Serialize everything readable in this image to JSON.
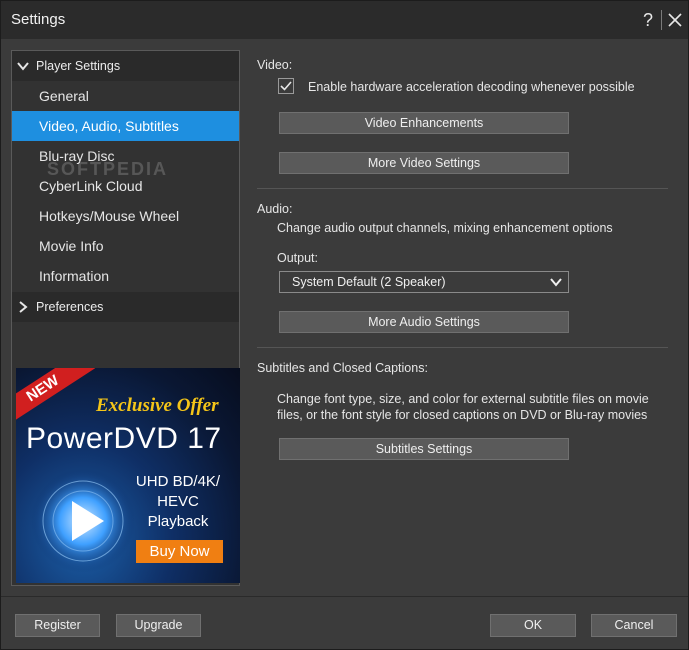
{
  "window": {
    "title": "Settings"
  },
  "nav": {
    "player_settings": "Player Settings",
    "items": [
      "General",
      "Video, Audio, Subtitles",
      "Blu-ray Disc",
      "CyberLink Cloud",
      "Hotkeys/Mouse Wheel",
      "Movie Info",
      "Information"
    ],
    "preferences": "Preferences",
    "watermark": "SOFTPEDIA"
  },
  "ad": {
    "ribbon": "NEW",
    "offer": "Exclusive Offer",
    "product": "PowerDVD 17",
    "desc_lines": [
      "UHD BD/4K/",
      "HEVC",
      "Playback"
    ],
    "buy": "Buy Now"
  },
  "video": {
    "heading": "Video:",
    "hw_accel": "Enable hardware acceleration decoding whenever possible",
    "hw_accel_checked": true,
    "enhancements": "Video Enhancements",
    "more": "More Video Settings"
  },
  "audio": {
    "heading": "Audio:",
    "desc": "Change audio output channels, mixing enhancement options",
    "output_label": "Output:",
    "output_value": "System Default  (2 Speaker)",
    "more": "More Audio Settings"
  },
  "subtitles": {
    "heading": "Subtitles and Closed Captions:",
    "desc_line1": "Change font type, size, and color for external subtitle files on movie",
    "desc_line2": "files, or the font style for closed captions on DVD or Blu-ray movies",
    "button": "Subtitles Settings"
  },
  "footer": {
    "register": "Register",
    "upgrade": "Upgrade",
    "ok": "OK",
    "cancel": "Cancel"
  },
  "colors": {
    "accent": "#1e8fe0",
    "buy": "#f07f12",
    "ribbon": "#d11f1f",
    "offer": "#f5c518"
  },
  "icons": {
    "help": "help-icon",
    "close": "close-icon",
    "expand": "chevron-down-icon",
    "collapse": "chevron-right-icon",
    "check": "check-icon",
    "dropdown": "chevron-down-icon",
    "play": "play-disc-icon"
  }
}
